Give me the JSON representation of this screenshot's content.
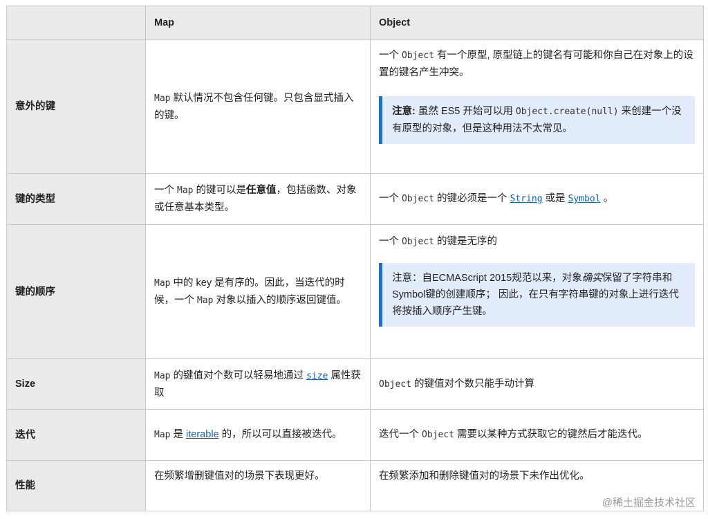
{
  "header": {
    "col1": "",
    "col2": "Map",
    "col3": "Object"
  },
  "rows": [
    {
      "label": "意外的键",
      "map": {
        "code": "Map",
        "text": " 默认情况不包含任何键。只包含显式插入的键。"
      },
      "object": {
        "text1": "一个 ",
        "code": "Object",
        "text2": " 有一个原型, 原型链上的键名有可能和你自己在对象上的设置的键名产生冲突。",
        "note": {
          "label": "注意:",
          "text1": " 虽然 ES5 开始可以用 ",
          "code": "Object.create(null)",
          "text2": " 来创建一个没有原型的对象，但是这种用法不太常见。"
        }
      }
    },
    {
      "label": "键的类型",
      "map": {
        "text1": "一个 ",
        "code": "Map",
        "text2": " 的键可以是",
        "bold": "任意值",
        "text3": "，包括函数、对象或任意基本类型。"
      },
      "object": {
        "text1": "一个 ",
        "code": "Object",
        "text2": " 的键必须是一个 ",
        "link1": "String",
        "text3": " 或是 ",
        "link2": "Symbol",
        "text4": " 。"
      }
    },
    {
      "label": "键的顺序",
      "map": {
        "code1": "Map",
        "text1": " 中的 key 是有序的。因此，当迭代的时候，一个 ",
        "code2": "Map",
        "text2": " 对象以插入的顺序返回键值。"
      },
      "object": {
        "text1": "一个 ",
        "code": "Object",
        "text2": " 的键是无序的",
        "note": {
          "text1": "注意：自ECMAScript 2015规范以来，对象",
          "italic": "确实",
          "text2": "保留了字符串和Symbol键的创建顺序； 因此，在只有字符串键的对象上进行迭代将按插入顺序产生键。"
        }
      }
    },
    {
      "label": "Size",
      "map": {
        "code": "Map",
        "text1": " 的键值对个数可以轻易地通过 ",
        "link": "size",
        "text2": " 属性获取"
      },
      "object": {
        "code": "Object",
        "text": " 的键值对个数只能手动计算"
      }
    },
    {
      "label": "迭代",
      "map": {
        "code": "Map",
        "text1": " 是 ",
        "link": "iterable",
        "text2": " 的，所以可以直接被迭代。"
      },
      "object": {
        "text1": "迭代一个 ",
        "code": "Object",
        "text2": " 需要以某种方式获取它的键然后才能迭代。"
      }
    },
    {
      "label": "性能",
      "map": {
        "text": "在频繁增删键值对的场景下表现更好。"
      },
      "object": {
        "text": "在频繁添加和删除键值对的场景下未作出优化。"
      }
    }
  ],
  "watermark": "@稀土掘金技术社区",
  "colors": {
    "header_bg": "#eaeaea",
    "note_bg": "#e2ecfb",
    "note_border": "#2a6fb5",
    "link": "#1a5ea8"
  }
}
